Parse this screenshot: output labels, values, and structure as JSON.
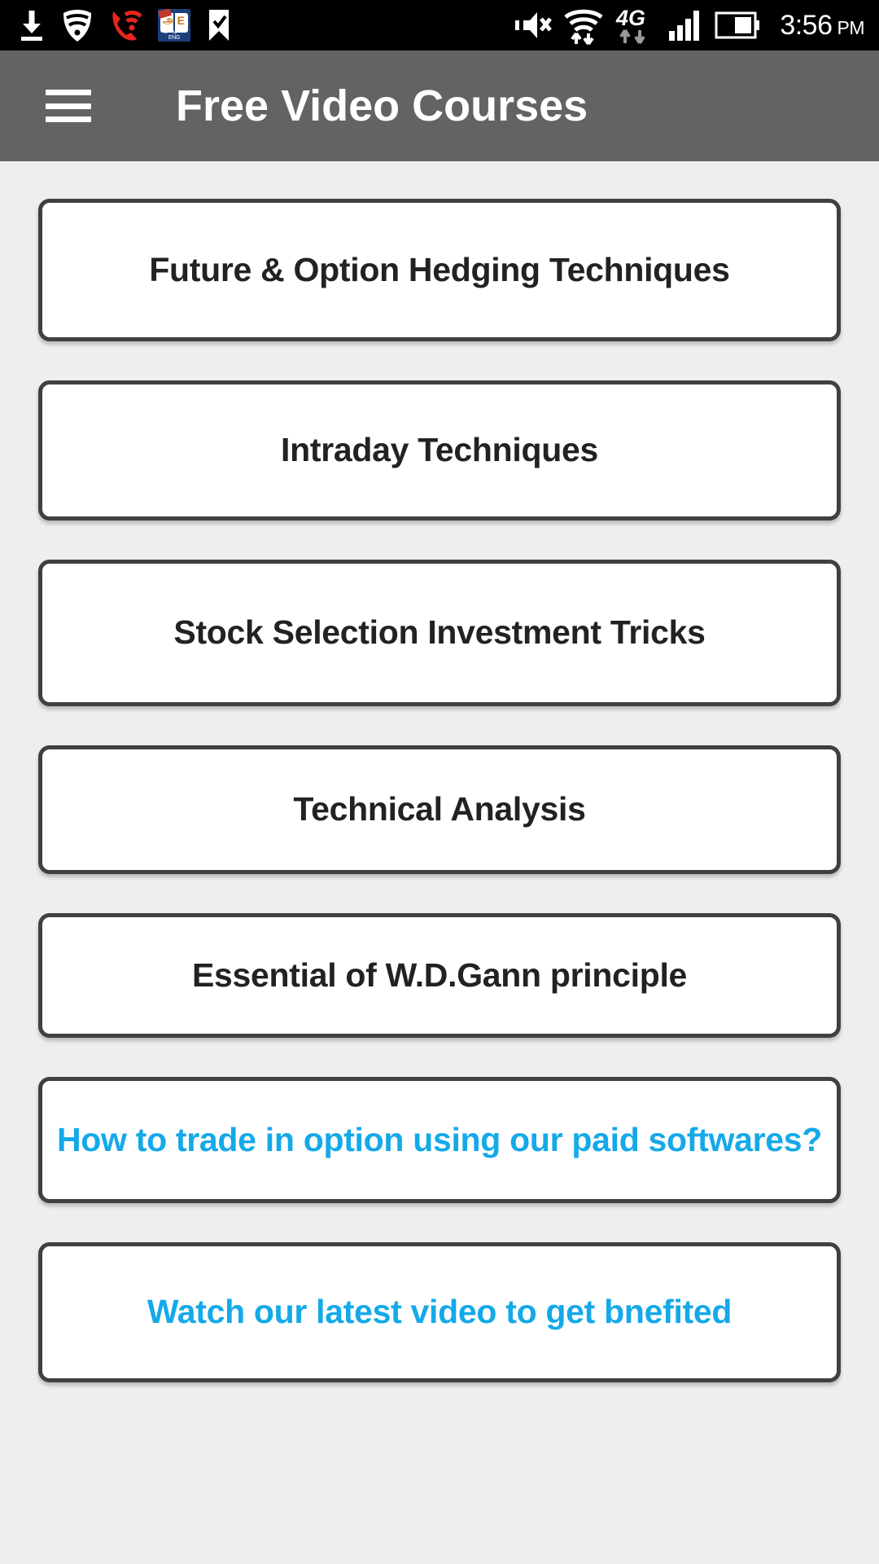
{
  "statusbar": {
    "time": "3:56",
    "ampm": "PM",
    "left_icons": [
      {
        "name": "download-icon",
        "label": "download"
      },
      {
        "name": "wifi-shield-icon",
        "label": "wifi calling"
      },
      {
        "name": "vowifi-call-icon",
        "label": "wifi call"
      },
      {
        "name": "dictionary-app-icon",
        "label": "Tamil English dictionary",
        "tamil": "அ",
        "english": "E",
        "footer": "தமிழ் ↔ ENG"
      },
      {
        "name": "checkmark-flag-icon",
        "label": "task"
      }
    ],
    "right_icons": [
      {
        "name": "volume-mute-icon",
        "label": "muted"
      },
      {
        "name": "wifi-data-icon",
        "label": "wifi data"
      },
      {
        "name": "network-4g-icon",
        "label": "4G",
        "text": "4G"
      },
      {
        "name": "signal-bars-icon",
        "label": "signal"
      },
      {
        "name": "battery-icon",
        "label": "battery"
      }
    ]
  },
  "appbar": {
    "menu_icon": "hamburger-menu-icon",
    "title": "Free Video Courses"
  },
  "colors": {
    "appbar_bg": "#646264",
    "page_bg": "#eeeeee",
    "card_bg": "#ffffff",
    "card_border": "#413f3f",
    "text_primary": "#222222",
    "accent": "#14a9e8",
    "statusbar_bg": "#000000"
  },
  "courses": [
    {
      "label": "Future & Option Hedging Techniques",
      "accent": false
    },
    {
      "label": "Intraday Techniques",
      "accent": false
    },
    {
      "label": "Stock Selection Investment Tricks",
      "accent": false
    },
    {
      "label": "Technical Analysis",
      "accent": false
    },
    {
      "label": "Essential of W.D.Gann principle",
      "accent": false
    },
    {
      "label": "How to trade in option using our paid softwares?",
      "accent": true
    },
    {
      "label": "Watch our latest video to get bnefited",
      "accent": true
    }
  ]
}
